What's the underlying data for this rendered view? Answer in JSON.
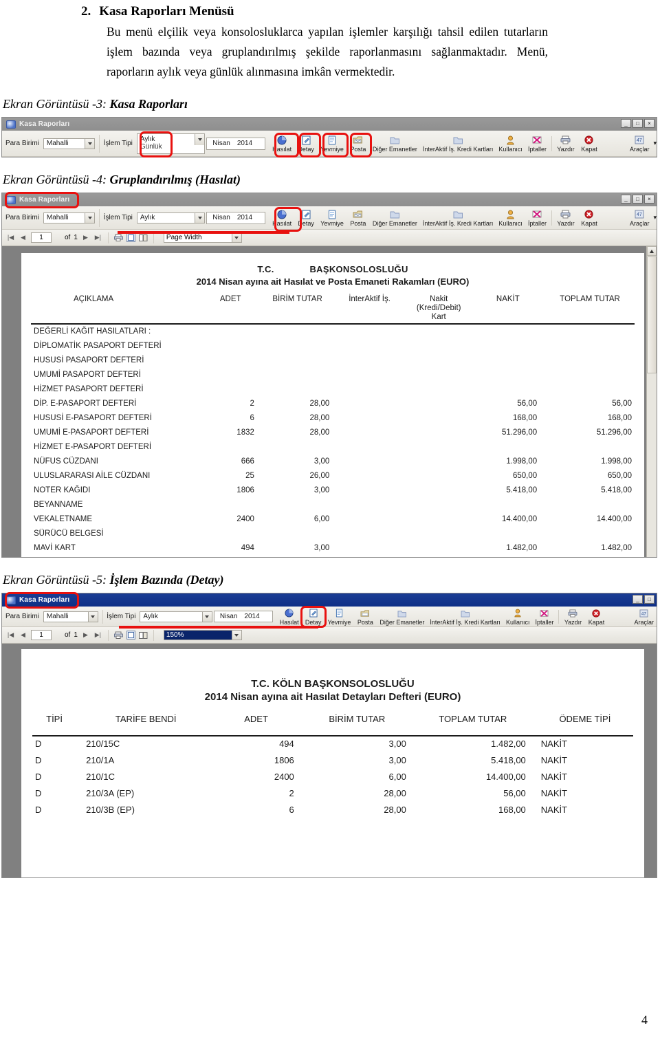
{
  "document": {
    "section_number": "2.",
    "section_title": "Kasa Raporları Menüsü",
    "paragraph": "Bu menü elçilik veya konsolosluklarca yapılan işlemler karşılığı tahsil edilen tutarların işlem bazında veya gruplandırılmış şekilde raporlanmasını sağlanmaktadır. Menü, raporların aylık veya günlük alınmasına imkân vermektedir.",
    "page_number": "4"
  },
  "captions": {
    "cap3_prefix": "Ekran Görüntüsü -3: ",
    "cap3_bold": "Kasa Raporları",
    "cap4_prefix": "Ekran Görüntüsü -4: ",
    "cap4_bold": "Gruplandırılmış (Hasılat)",
    "cap5_prefix": "Ekran Görüntüsü -5: ",
    "cap5_bold": "İşlem Bazında (Detay)"
  },
  "app": {
    "window_title": "Kasa Raporları",
    "win_buttons": [
      "_",
      "□",
      "×"
    ],
    "form": {
      "para_birimi_label": "Para Birimi",
      "para_birimi_value": "Mahalli",
      "islem_tipi_label": "İşlem Tipi",
      "islem_tipi_value": "Aylık",
      "islem_tipi_option2": "Günlük",
      "month_value": "Nisan",
      "year_value": "2014"
    },
    "toolbar": [
      {
        "label": "Hasılat",
        "icon": "pie-chart-icon"
      },
      {
        "label": "Detay",
        "icon": "edit-document-icon"
      },
      {
        "label": "Yevmiye",
        "icon": "document-icon"
      },
      {
        "label": "Posta",
        "icon": "mail-folder-icon"
      },
      {
        "label": "Diğer Emanetler",
        "icon": "folder-icon"
      },
      {
        "label": "İnterAktif İş. Kredi Kartları",
        "icon": "folder-icon"
      },
      {
        "label": "Kullanıcı",
        "icon": "user-icon"
      },
      {
        "label": "İptaller",
        "icon": "cancel-icon"
      },
      {
        "label": "Yazdır",
        "icon": "printer-icon"
      },
      {
        "label": "Kapat",
        "icon": "close-circle-icon"
      },
      {
        "label": "Araçlar",
        "icon": "tools-icon"
      }
    ],
    "navbar": {
      "page_current": "1",
      "of_label": "of",
      "page_total": "1",
      "zoom_pagewidth": "Page Width",
      "zoom_150": "150%"
    }
  },
  "report_hasilat": {
    "org_line1_left": "T.C.",
    "org_line1_right": "BAŞKONSOLOSLUĞU",
    "org_line2": "2014 Nisan ayına ait Hasılat ve Posta Emaneti Rakamları (EURO)",
    "columns": [
      "AÇIKLAMA",
      "ADET",
      "BİRİM TUTAR",
      "İnterAktif İş.",
      "Nakit\n(Kredi/Debit)\nKart",
      "NAKİT",
      "TOPLAM TUTAR"
    ],
    "col_aciklama": "AÇIKLAMA",
    "col_adet": "ADET",
    "col_birim": "BİRİM TUTAR",
    "col_interaktif": "İnterAktif İş.",
    "col_nakit_kart_l1": "Nakit",
    "col_nakit_kart_l2": "(Kredi/Debit)",
    "col_nakit_kart_l3": "Kart",
    "col_nakit": "NAKİT",
    "col_toplam": "TOPLAM TUTAR",
    "rows": [
      {
        "aciklama": "DEĞERLİ KAĞIT HASILATLARI :",
        "adet": "",
        "birim": "",
        "nakit": "",
        "toplam": ""
      },
      {
        "aciklama": "DİPLOMATİK PASAPORT DEFTERİ",
        "adet": "",
        "birim": "",
        "nakit": "",
        "toplam": ""
      },
      {
        "aciklama": "HUSUSİ PASAPORT DEFTERİ",
        "adet": "",
        "birim": "",
        "nakit": "",
        "toplam": ""
      },
      {
        "aciklama": "UMUMİ PASAPORT DEFTERİ",
        "adet": "",
        "birim": "",
        "nakit": "",
        "toplam": ""
      },
      {
        "aciklama": "HİZMET PASAPORT DEFTERİ",
        "adet": "",
        "birim": "",
        "nakit": "",
        "toplam": ""
      },
      {
        "aciklama": "DİP. E-PASAPORT DEFTERİ",
        "adet": "2",
        "birim": "28,00",
        "nakit": "56,00",
        "toplam": "56,00"
      },
      {
        "aciklama": "HUSUSİ E-PASAPORT DEFTERİ",
        "adet": "6",
        "birim": "28,00",
        "nakit": "168,00",
        "toplam": "168,00"
      },
      {
        "aciklama": "UMUMİ E-PASAPORT DEFTERİ",
        "adet": "1832",
        "birim": "28,00",
        "nakit": "51.296,00",
        "toplam": "51.296,00"
      },
      {
        "aciklama": "HİZMET E-PASAPORT DEFTERİ",
        "adet": "",
        "birim": "",
        "nakit": "",
        "toplam": ""
      },
      {
        "aciklama": "NÜFUS CÜZDANI",
        "adet": "666",
        "birim": "3,00",
        "nakit": "1.998,00",
        "toplam": "1.998,00"
      },
      {
        "aciklama": "ULUSLARARASI AİLE CÜZDANI",
        "adet": "25",
        "birim": "26,00",
        "nakit": "650,00",
        "toplam": "650,00"
      },
      {
        "aciklama": "NOTER KAĞIDI",
        "adet": "1806",
        "birim": "3,00",
        "nakit": "5.418,00",
        "toplam": "5.418,00"
      },
      {
        "aciklama": "BEYANNAME",
        "adet": "",
        "birim": "",
        "nakit": "",
        "toplam": ""
      },
      {
        "aciklama": "VEKALETNAME",
        "adet": "2400",
        "birim": "6,00",
        "nakit": "14.400,00",
        "toplam": "14.400,00"
      },
      {
        "aciklama": "SÜRÜCÜ BELGESİ",
        "adet": "",
        "birim": "",
        "nakit": "",
        "toplam": ""
      },
      {
        "aciklama": "MAVİ KART",
        "adet": "494",
        "birim": "3,00",
        "nakit": "1.482,00",
        "toplam": "1.482,00"
      }
    ]
  },
  "report_detay": {
    "org_line1": "T.C. KÖLN BAŞKONSOLOSLUĞU",
    "org_line2": "2014 Nisan ayına ait Hasılat Detayları Defteri (EURO)",
    "col_tipi": "TİPİ",
    "col_tarife": "TARİFE BENDİ",
    "col_adet": "ADET",
    "col_birim": "BİRİM TUTAR",
    "col_toplam": "TOPLAM TUTAR",
    "col_odeme": "ÖDEME TİPİ",
    "rows": [
      {
        "tipi": "D",
        "tarife": "210/15C",
        "adet": "494",
        "birim": "3,00",
        "toplam": "1.482,00",
        "odeme": "NAKİT"
      },
      {
        "tipi": "D",
        "tarife": "210/1A",
        "adet": "1806",
        "birim": "3,00",
        "toplam": "5.418,00",
        "odeme": "NAKİT"
      },
      {
        "tipi": "D",
        "tarife": "210/1C",
        "adet": "2400",
        "birim": "6,00",
        "toplam": "14.400,00",
        "odeme": "NAKİT"
      },
      {
        "tipi": "D",
        "tarife": "210/3A (EP)",
        "adet": "2",
        "birim": "28,00",
        "toplam": "56,00",
        "odeme": "NAKİT"
      },
      {
        "tipi": "D",
        "tarife": "210/3B (EP)",
        "adet": "6",
        "birim": "28,00",
        "toplam": "168,00",
        "odeme": "NAKİT"
      }
    ]
  },
  "colors": {
    "highlight_red": "#e8110f",
    "titlebar_blue": "#12307f",
    "titlebar_grey": "#919191",
    "viewer_grey": "#808080"
  }
}
